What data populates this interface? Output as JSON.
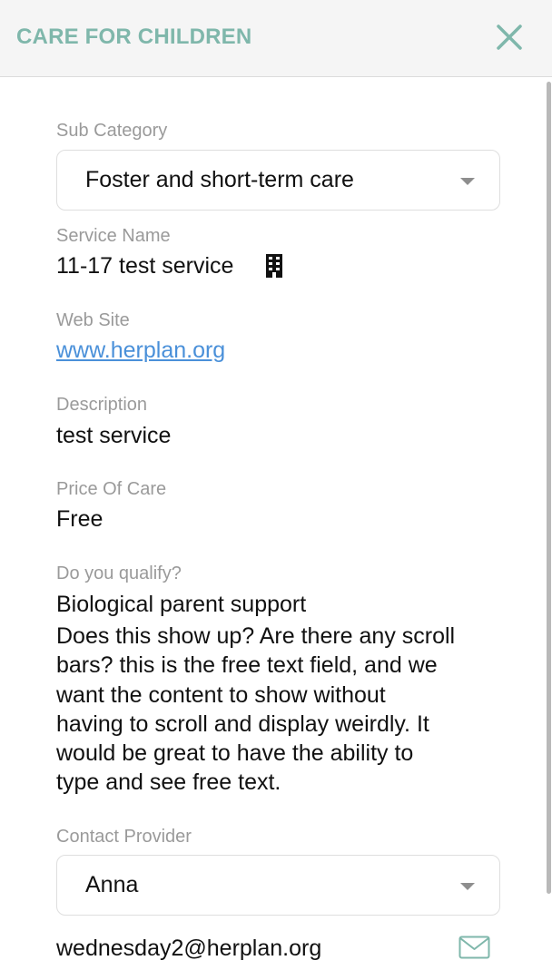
{
  "header": {
    "title": "CARE FOR CHILDREN",
    "close_icon": "close-icon",
    "accent_color": "#7fb7ab"
  },
  "sub_category": {
    "label": "Sub Category",
    "selected": "Foster and short-term care"
  },
  "service_name": {
    "label": "Service Name",
    "value": "11-17 test service",
    "icon": "building-icon"
  },
  "web_site": {
    "label": "Web Site",
    "value": "www.herplan.org",
    "link_color": "#4a90d9"
  },
  "description": {
    "label": "Description",
    "value": "test service"
  },
  "price_of_care": {
    "label": "Price Of Care",
    "value": "Free"
  },
  "qualify": {
    "label": "Do you qualify?",
    "value": "Biological parent support",
    "free_text_lines": [
      "Does this show up? Are there any scroll",
      "bars? this is the free text field, and we",
      "want the content to show without",
      "having to scroll and display weirdly. It",
      "would be great to have the ability to",
      "type and see free text."
    ]
  },
  "contact_provider": {
    "label": "Contact Provider",
    "selected": "Anna",
    "email": "wednesday2@herplan.org",
    "email_icon": "mail-icon"
  }
}
